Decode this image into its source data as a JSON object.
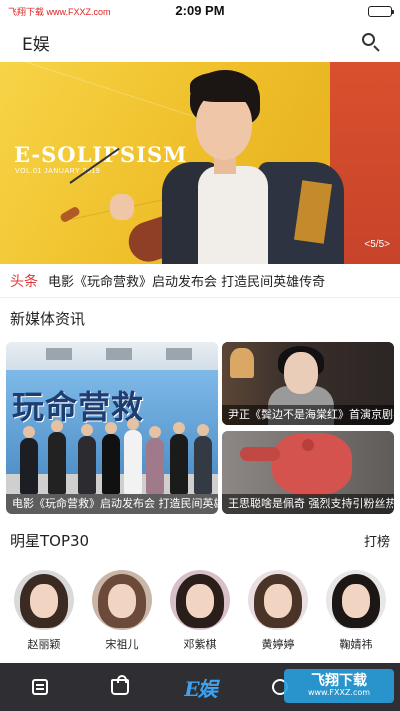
{
  "status_bar": {
    "source_text": "飞翔下载 www.FXXZ.com",
    "time": "2:09 PM"
  },
  "header": {
    "title": "E娱",
    "search_icon": "search-icon"
  },
  "banner": {
    "title": "E-SOLIPSISM",
    "subtitle": "VOL.01 JANUARY 2019",
    "counter": "<5/5>"
  },
  "ticker": {
    "tag": "头条",
    "text": "电影《玩命营救》启动发布会  打造民间英雄传奇"
  },
  "news": {
    "section_title": "新媒体资讯",
    "big": {
      "poster_text": "玩命营救",
      "caption": "电影《玩命营救》启动发布会  打造民间英雄传奇"
    },
    "small": [
      {
        "caption": "尹正《鬓边不是海棠红》首演京剧名伶"
      },
      {
        "caption": "王思聪啥是佩奇 强烈支持引粉丝热议"
      }
    ]
  },
  "stars": {
    "section_title": "明星TOP30",
    "action": "打榜",
    "items": [
      {
        "name": "赵丽颖",
        "hair": "#3a2a22"
      },
      {
        "name": "宋祖儿",
        "hair": "#6b4a3a"
      },
      {
        "name": "邓紫棋",
        "hair": "#2a1e1a"
      },
      {
        "name": "黄婷婷",
        "hair": "#4a3428"
      },
      {
        "name": "鞠婧祎",
        "hair": "#1c1614"
      }
    ]
  },
  "tab_bar": {
    "watermark": "飞翔下载",
    "watermark_url": "www.FXXZ.com"
  },
  "colors": {
    "accent_red": "#e23a3a",
    "tab_bar_bg": "#2f2f33",
    "banner_yellow": "#efc02b"
  }
}
